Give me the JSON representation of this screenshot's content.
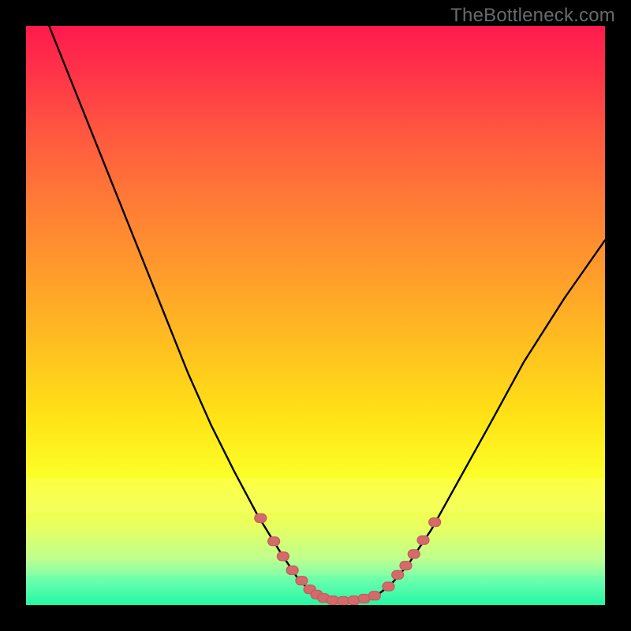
{
  "watermark": "TheBottleneck.com",
  "colors": {
    "black": "#000000",
    "marker_fill": "#d46a6a",
    "marker_stroke": "#c55a5a"
  },
  "chart_data": {
    "type": "line",
    "title": "",
    "xlabel": "",
    "ylabel": "",
    "xlim": [
      0,
      100
    ],
    "ylim": [
      0,
      100
    ],
    "series": [
      {
        "name": "left-curve",
        "x": [
          4,
          8,
          12,
          16,
          20,
          24,
          28,
          32,
          36,
          40,
          44,
          47,
          49.5,
          51
        ],
        "values": [
          100,
          90,
          80,
          70,
          60,
          50,
          40,
          31,
          23,
          15.5,
          9,
          4.5,
          2,
          1.2
        ]
      },
      {
        "name": "valley-floor",
        "x": [
          51,
          53,
          55,
          57,
          59,
          60.5
        ],
        "values": [
          1.2,
          0.8,
          0.7,
          0.8,
          1.0,
          1.6
        ]
      },
      {
        "name": "right-curve",
        "x": [
          60.5,
          63,
          66,
          70,
          75,
          80,
          86,
          93,
          100
        ],
        "values": [
          1.6,
          3.5,
          7,
          13,
          22,
          31,
          42,
          53,
          63
        ]
      }
    ],
    "markers": [
      {
        "x": 40.5,
        "y": 15.0
      },
      {
        "x": 42.8,
        "y": 11.0
      },
      {
        "x": 44.4,
        "y": 8.4
      },
      {
        "x": 46.0,
        "y": 6.0
      },
      {
        "x": 47.6,
        "y": 4.2
      },
      {
        "x": 49.0,
        "y": 2.7
      },
      {
        "x": 50.2,
        "y": 1.8
      },
      {
        "x": 51.4,
        "y": 1.2
      },
      {
        "x": 53.0,
        "y": 0.8
      },
      {
        "x": 54.8,
        "y": 0.7
      },
      {
        "x": 56.6,
        "y": 0.8
      },
      {
        "x": 58.4,
        "y": 1.1
      },
      {
        "x": 60.2,
        "y": 1.6
      },
      {
        "x": 62.6,
        "y": 3.2
      },
      {
        "x": 64.2,
        "y": 5.2
      },
      {
        "x": 65.6,
        "y": 6.8
      },
      {
        "x": 67.0,
        "y": 8.8
      },
      {
        "x": 68.6,
        "y": 11.2
      },
      {
        "x": 70.6,
        "y": 14.3
      }
    ],
    "bands": [
      {
        "name": "yellow-band",
        "y0": 16,
        "y1": 22
      },
      {
        "name": "green-band",
        "y0": 0,
        "y1": 5
      }
    ]
  }
}
